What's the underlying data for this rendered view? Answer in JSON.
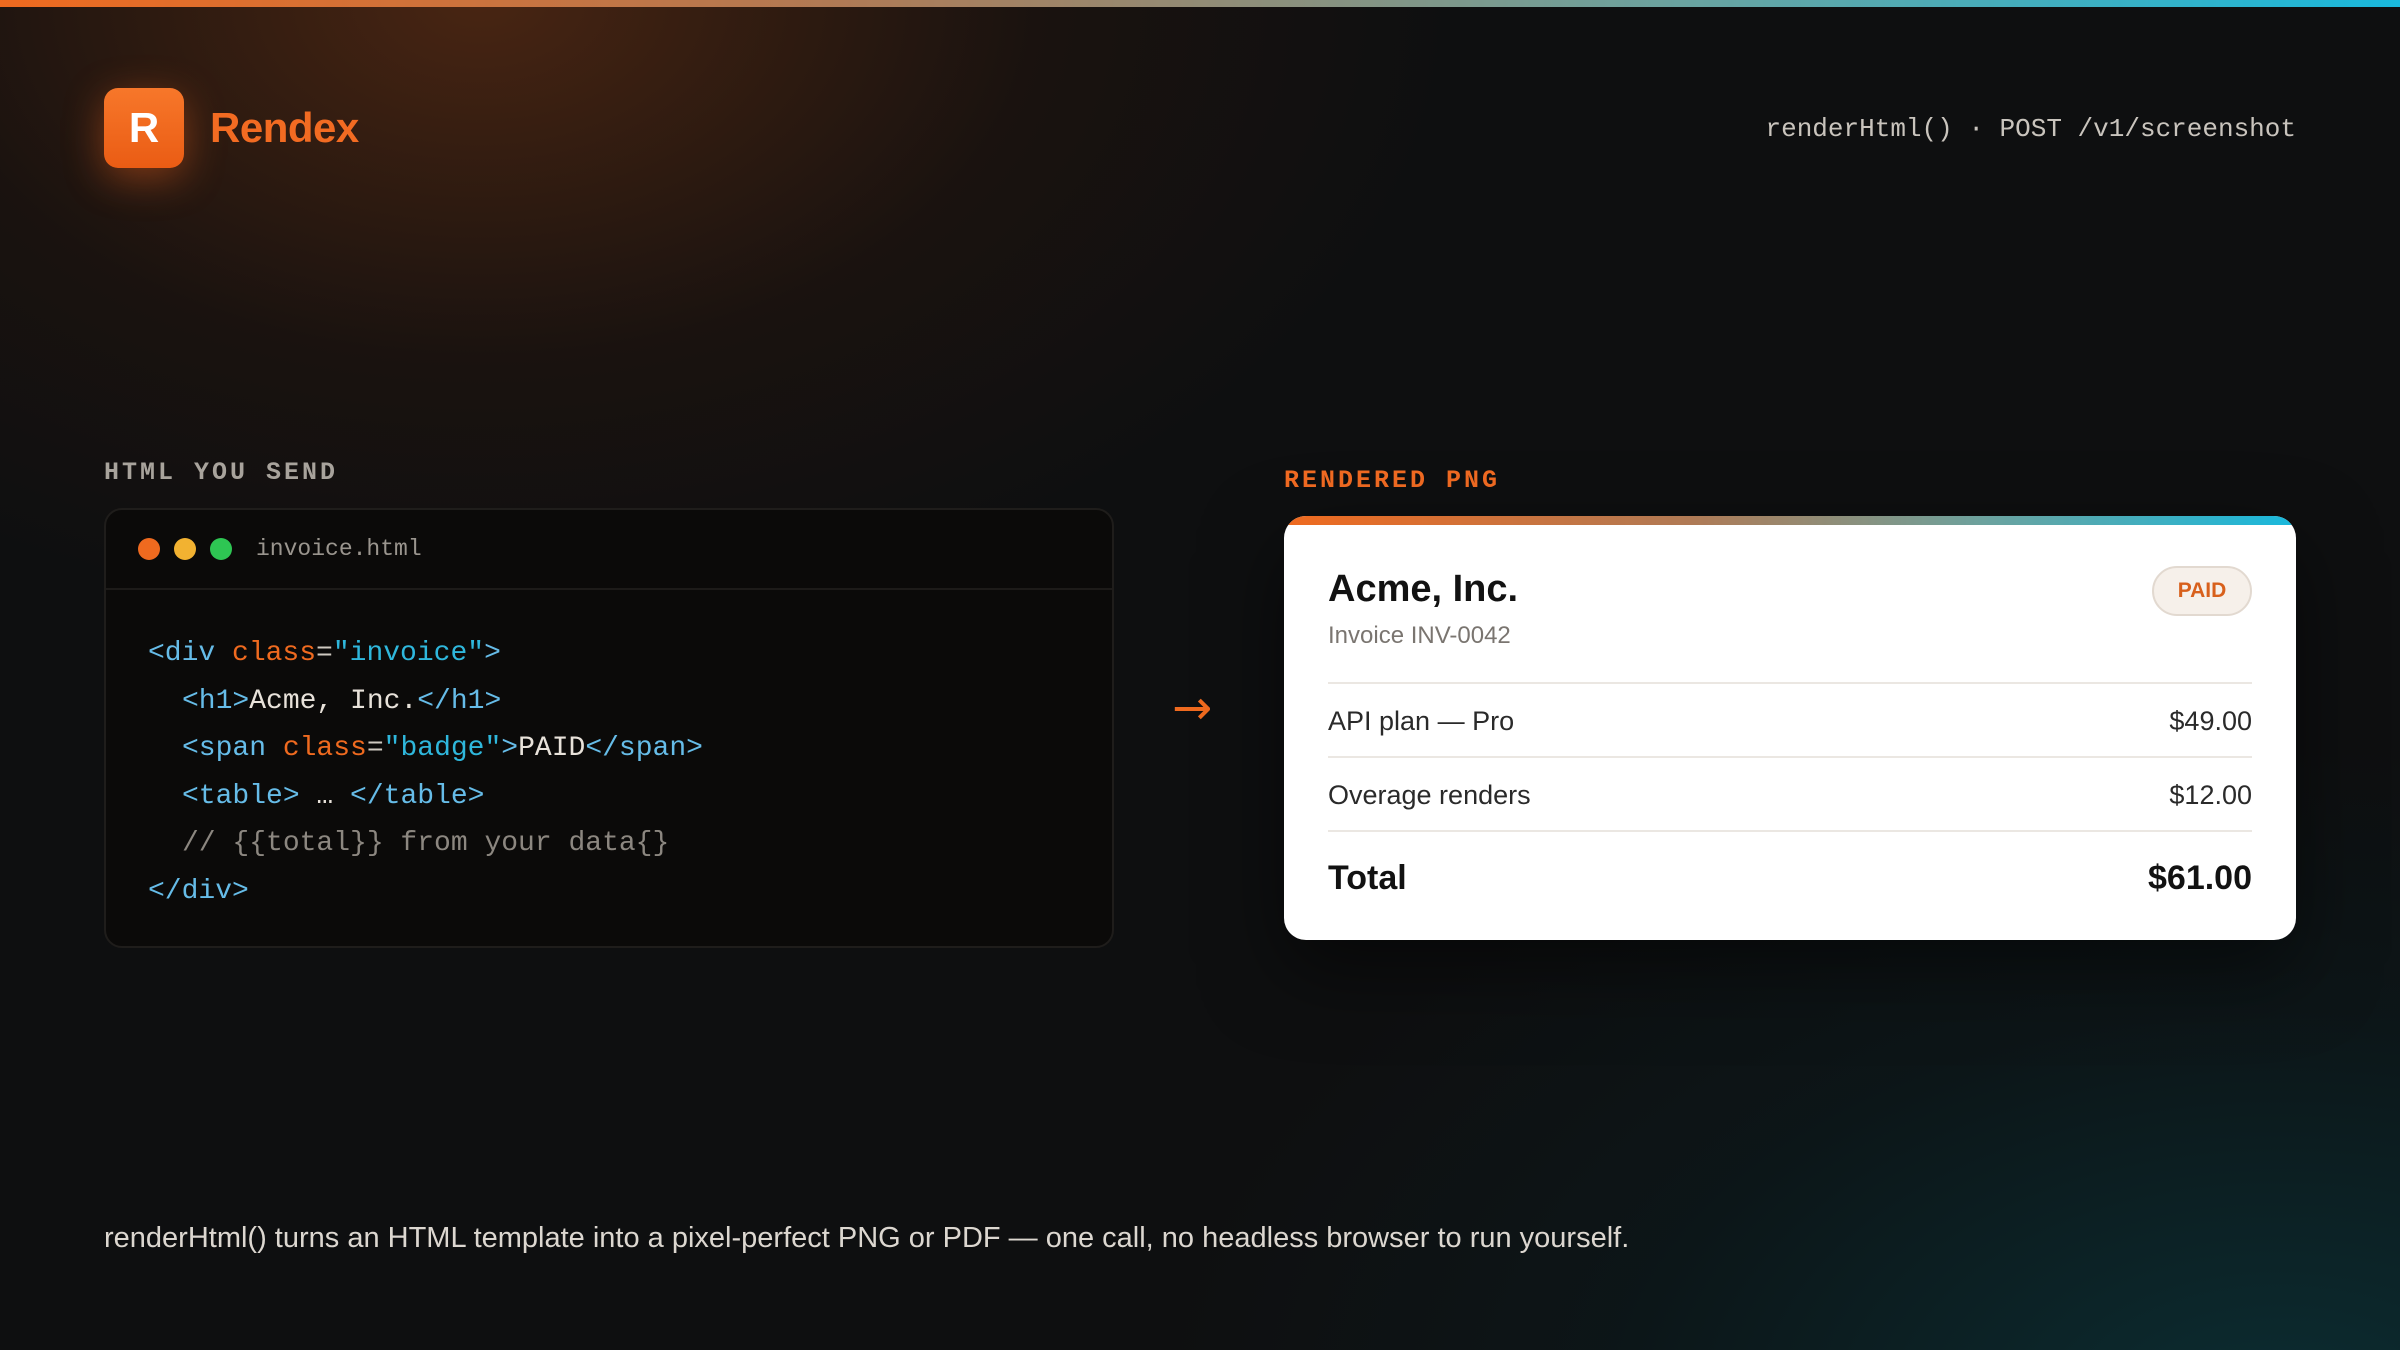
{
  "brand": {
    "logo_letter": "R",
    "name": "Rendex"
  },
  "header": {
    "endpoint": "renderHtml() · POST /v1/screenshot"
  },
  "left_label": "HTML YOU SEND",
  "right_label": "RENDERED PNG",
  "code": {
    "filename": "invoice.html",
    "line1": {
      "open": "<div ",
      "attr": "class",
      "eq": "=",
      "str": "\"invoice\"",
      "close": ">"
    },
    "line2": {
      "open": "<h1>",
      "text": "Acme, Inc.",
      "close": "</h1>"
    },
    "line3": {
      "open": "<span ",
      "attr": "class",
      "eq": "=",
      "str": "\"badge\"",
      "gt": ">",
      "text": "PAID",
      "close": "</span>"
    },
    "line4": {
      "open": "<table>",
      "text": " … ",
      "close": "</table>"
    },
    "line5": {
      "comment": "// {{total}} from your data{}"
    },
    "line6": {
      "close": "</div>"
    }
  },
  "arrow": "→",
  "invoice": {
    "company": "Acme, Inc.",
    "number": "Invoice INV-0042",
    "status": "PAID",
    "items": [
      {
        "label": "API plan — Pro",
        "amount": "$49.00"
      },
      {
        "label": "Overage renders",
        "amount": "$12.00"
      }
    ],
    "total_label": "Total",
    "total_amount": "$61.00"
  },
  "footer": "renderHtml() turns an HTML template into a pixel-perfect PNG or PDF — one call, no headless browser to run yourself.",
  "colors": {
    "accent": "#ef6a1f",
    "teal": "#19b9dd",
    "code_tag": "#66bce8"
  }
}
